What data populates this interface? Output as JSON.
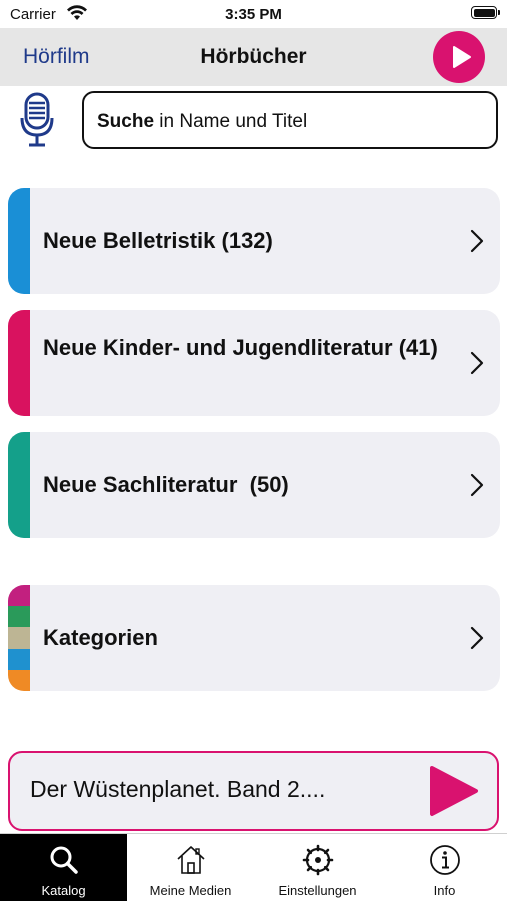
{
  "status_bar": {
    "carrier": "Carrier",
    "time": "3:35 PM"
  },
  "nav": {
    "back_label": "Hörfilm",
    "title": "Hörbücher",
    "play_icon": "play-icon",
    "accent_color": "#d9126f"
  },
  "search": {
    "placeholder_bold": "Suche",
    "placeholder_rest": " in Name und Titel",
    "mic_icon": "microphone-icon"
  },
  "categories": [
    {
      "label": "Neue Belletristik (132)",
      "color": "#1a8fd6"
    },
    {
      "label": "Neue Kinder- und Jugendliteratur (41)",
      "color": "#d9125f"
    },
    {
      "label": "Neue Sachliteratur  (50)",
      "color": "#14a08a"
    },
    {
      "label": "Kategorien",
      "colors": [
        "#c2207f",
        "#2a9a5a",
        "#bdb594",
        "#1f91cf",
        "#ef8a25"
      ]
    }
  ],
  "player": {
    "title": "Der Wüstenplanet. Band 2....",
    "play_icon": "play-icon"
  },
  "tabs": [
    {
      "label": "Katalog",
      "icon": "search-icon",
      "active": true
    },
    {
      "label": "Meine Medien",
      "icon": "house-icon",
      "active": false
    },
    {
      "label": "Einstellungen",
      "icon": "gear-icon",
      "active": false
    },
    {
      "label": "Info",
      "icon": "info-icon",
      "active": false
    }
  ]
}
